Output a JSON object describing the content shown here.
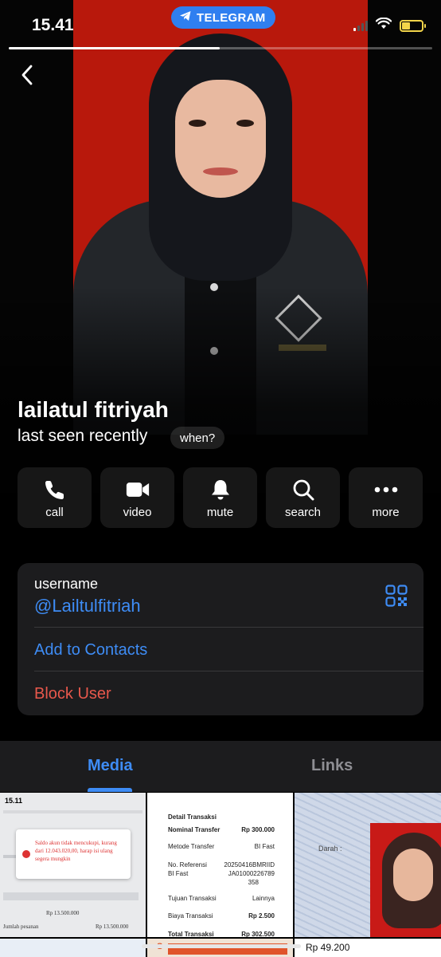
{
  "status_bar": {
    "time": "15.41",
    "app_pill": "TELEGRAM"
  },
  "profile": {
    "name": "lailatul fitriyah",
    "last_seen": "last seen recently",
    "when_label": "when?"
  },
  "actions": [
    {
      "label": "call",
      "icon": "phone-icon"
    },
    {
      "label": "video",
      "icon": "video-camera-icon"
    },
    {
      "label": "mute",
      "icon": "bell-icon"
    },
    {
      "label": "search",
      "icon": "search-icon"
    },
    {
      "label": "more",
      "icon": "more-dots-icon"
    }
  ],
  "info": {
    "username_label": "username",
    "username": "@Lailtulfitriah",
    "add_to_contacts": "Add to Contacts",
    "block_user": "Block User"
  },
  "tabs": {
    "media": "Media",
    "links": "Links",
    "active": "Media"
  },
  "media_thumbs": {
    "t1_time": "15.11",
    "t1_popup": "Saldo akun tidak mencukupi, kurang dari 12.043.020,00, harap isi ulang segera mungkin",
    "t1_price": "Rp 13.500.000",
    "t1_jumlah": "Jumlah pesanan",
    "t1_jumlah_value": "Rp 13.500.000",
    "t2_title": "Detail Transaksi",
    "t2_rows": [
      {
        "k": "Nominal Transfer",
        "v": "Rp 300.000",
        "bold": true
      },
      {
        "k": "Metode Transfer",
        "v": "BI Fast",
        "bold": false
      },
      {
        "k": "No. Referensi",
        "v": "20250416BMRIID",
        "bold": false
      },
      {
        "k": "BI Fast",
        "v": "JA01000226789",
        "bold": false
      },
      {
        "k": "",
        "v": "358",
        "bold": false
      },
      {
        "k": "Tujuan Transaksi",
        "v": "Lainnya",
        "bold": false
      },
      {
        "k": "Biaya Transaksi",
        "v": "Rp 2.500",
        "bold": true
      },
      {
        "k": "Total Transaksi",
        "v": "Rp 302.500",
        "bold": true
      }
    ],
    "t3_label": "Darah :",
    "t5_label": "S",
    "t6_price": "Rp 49.200"
  },
  "colors": {
    "accent_blue": "#3e8cf5",
    "destructive_red": "#e8584c",
    "card_bg": "#1c1c1e",
    "photo_bg": "#b8180c"
  }
}
